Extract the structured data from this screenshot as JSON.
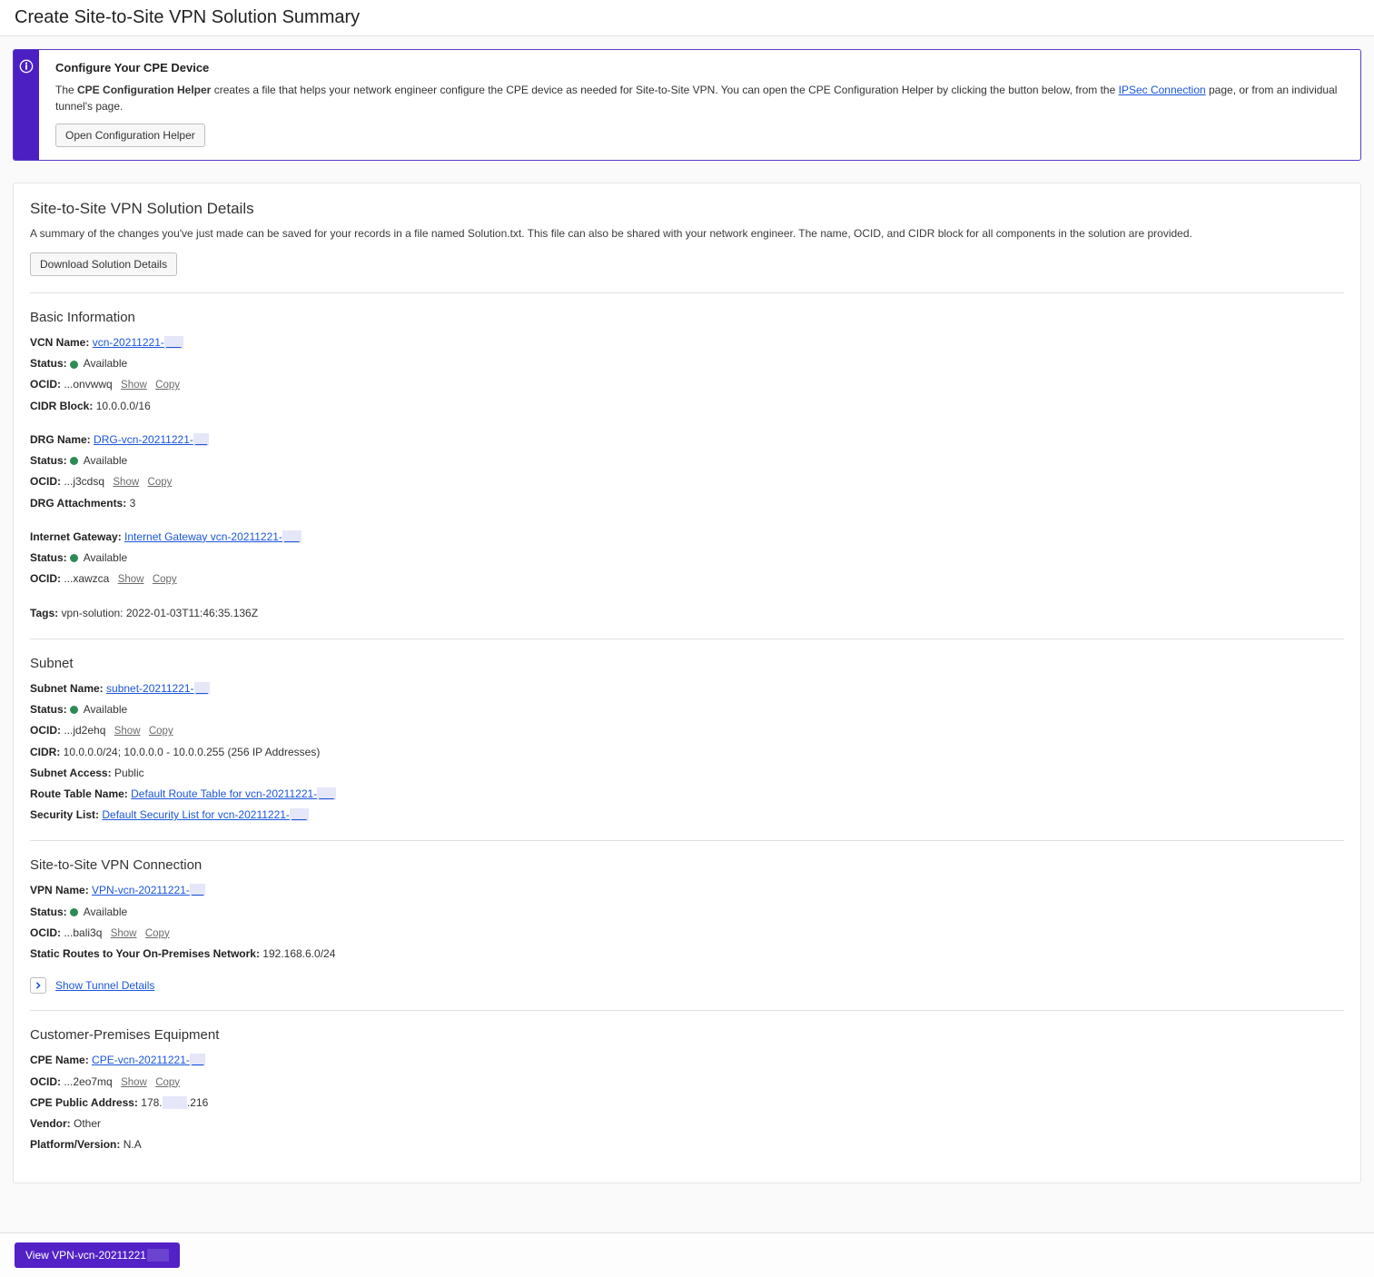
{
  "header": {
    "title": "Create Site-to-Site VPN Solution Summary"
  },
  "banner": {
    "title": "Configure Your CPE Device",
    "desc_prefix": "The ",
    "desc_bold": "CPE Configuration Helper",
    "desc_mid": " creates a file that helps your network engineer configure the CPE device as needed for Site-to-Site VPN. You can open the CPE Configuration Helper by clicking the button below, from the ",
    "desc_link": "IPSec Connection",
    "desc_suffix": " page, or from an individual tunnel's page.",
    "button": "Open Configuration Helper"
  },
  "details": {
    "head": "Site-to-Site VPN Solution Details",
    "desc": "A summary of the changes you've just made can be saved for your records in a file named Solution.txt. This file can also be shared with your network engineer. The name, OCID, and CIDR block for all components in the solution are provided.",
    "button": "Download Solution Details"
  },
  "labels": {
    "status": "Status:",
    "ocid": "OCID:",
    "show": "Show",
    "copy": "Copy",
    "available": "Available"
  },
  "basic": {
    "head": "Basic Information",
    "vcn": {
      "name_label": "VCN Name:",
      "name_link": "vcn-20211221-",
      "ocid_val": "...onvwwq",
      "cidr_label": "CIDR Block:",
      "cidr_val": "10.0.0.0/16"
    },
    "drg": {
      "name_label": "DRG Name:",
      "name_link": "DRG-vcn-20211221-",
      "ocid_val": "...j3cdsq",
      "attach_label": "DRG Attachments:",
      "attach_val": "3"
    },
    "igw": {
      "name_label": "Internet Gateway:",
      "name_link": "Internet Gateway vcn-20211221-",
      "ocid_val": "...xawzca"
    },
    "tags_label": "Tags:",
    "tags_val": "vpn-solution: 2022-01-03T11:46:35.136Z"
  },
  "subnet": {
    "head": "Subnet",
    "name_label": "Subnet Name:",
    "name_link": "subnet-20211221-",
    "ocid_val": "...jd2ehq",
    "cidr_label": "CIDR:",
    "cidr_val": "10.0.0.0/24; 10.0.0.0 - 10.0.0.255 (256 IP Addresses)",
    "access_label": "Subnet Access:",
    "access_val": "Public",
    "rt_label": "Route Table Name:",
    "rt_link": "Default Route Table for vcn-20211221-",
    "sl_label": "Security List:",
    "sl_link": "Default Security List for vcn-20211221-"
  },
  "vpn": {
    "head": "Site-to-Site VPN Connection",
    "name_label": "VPN Name:",
    "name_link": "VPN-vcn-20211221-",
    "ocid_val": "...bali3q",
    "routes_label": "Static Routes to Your On-Premises Network:",
    "routes_val": "192.168.6.0/24",
    "expand": "Show Tunnel Details"
  },
  "cpe": {
    "head": "Customer-Premises Equipment",
    "name_label": "CPE Name:",
    "name_link": "CPE-vcn-20211221-",
    "ocid_val": "...2eo7mq",
    "pubaddr_label": "CPE Public Address:",
    "pubaddr_pre": "178.",
    "pubaddr_post": ".216",
    "vendor_label": "Vendor:",
    "vendor_val": "Other",
    "platform_label": "Platform/Version:",
    "platform_val": "N.A"
  },
  "footer": {
    "btn_prefix": "View VPN-vcn-20211221"
  }
}
